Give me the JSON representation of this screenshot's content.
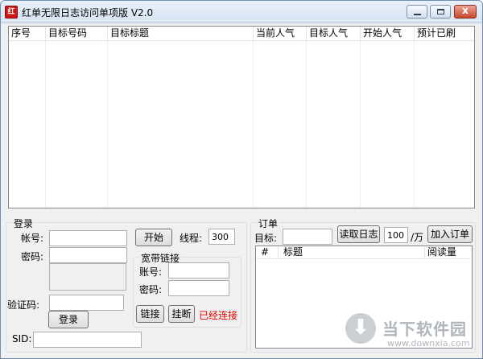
{
  "window": {
    "title": "红单无限日志访问单项版 V2.0",
    "icon_text": "红",
    "close_glyph": "x"
  },
  "main_list": {
    "columns": [
      "序号",
      "目标号码",
      "目标标题",
      "当前人气",
      "目标人气",
      "开始人气",
      "预计已刷"
    ]
  },
  "login": {
    "group_label": "登录",
    "account_label": "帐号:",
    "account_value": "",
    "password_label": "密码:",
    "password_value": "",
    "captcha_label": "验证码:",
    "captcha_value": "",
    "login_button": "登录",
    "sid_label": "SID:",
    "sid_value": ""
  },
  "control": {
    "start_button": "开始",
    "threads_label": "线程:",
    "threads_value": "300"
  },
  "broadband": {
    "group_label": "宽带链接",
    "account_label": "账号:",
    "account_value": "",
    "password_label": "密码:",
    "password_value": "",
    "connect_button": "链接",
    "hangup_button": "挂断",
    "status_text": "已经连接",
    "status_color": "#e00000"
  },
  "order": {
    "group_label": "订单",
    "target_label": "目标:",
    "target_value": "",
    "read_log_button": "读取日志",
    "quantity_value": "100",
    "unit_label": "/万",
    "add_order_button": "加入订单",
    "columns": [
      "#",
      "标题",
      "阅读量"
    ]
  },
  "watermark": {
    "title": "当下软件园",
    "url": "www.downxia.com",
    "logo_glyph": "⬇"
  }
}
